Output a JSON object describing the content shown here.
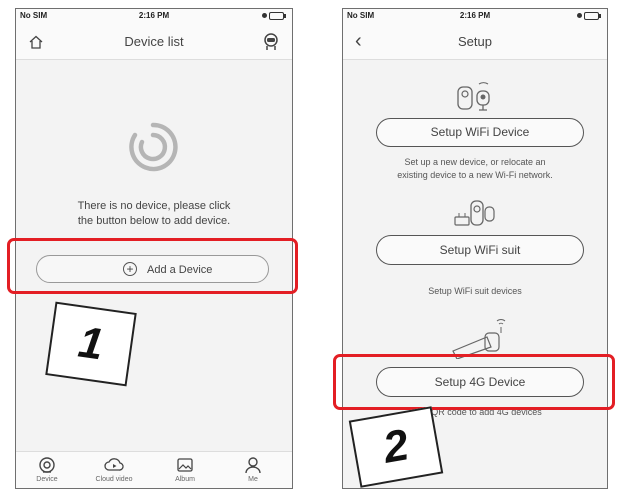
{
  "status_bar": {
    "carrier": "No SIM",
    "time": "2:16 PM"
  },
  "screen1": {
    "title": "Device list",
    "empty_message_line1": "There is no device, please click",
    "empty_message_line2": "the button below to add device.",
    "add_button_label": "Add a Device",
    "tabs": [
      {
        "label": "Device",
        "icon": "device-icon"
      },
      {
        "label": "Cloud video",
        "icon": "cloud-video-icon"
      },
      {
        "label": "Album",
        "icon": "album-icon"
      },
      {
        "label": "Me",
        "icon": "person-icon"
      }
    ]
  },
  "screen2": {
    "title": "Setup",
    "options": [
      {
        "label": "Setup WiFi Device",
        "desc_line1": "Set up a new device, or relocate an",
        "desc_line2": "existing device to a new Wi-Fi network.",
        "icon": "wifi-cameras-icon"
      },
      {
        "label": "Setup WiFi suit",
        "desc_line1": "Setup WiFi suit devices",
        "desc_line2": "",
        "icon": "nvr-kit-icon"
      },
      {
        "label": "Setup 4G Device",
        "desc_line1": "Scan QR code to add 4G devices",
        "desc_line2": "",
        "icon": "4g-camera-icon"
      }
    ]
  },
  "annotations": {
    "step1": "1",
    "step2": "2",
    "highlight_color": "#e31e24"
  }
}
